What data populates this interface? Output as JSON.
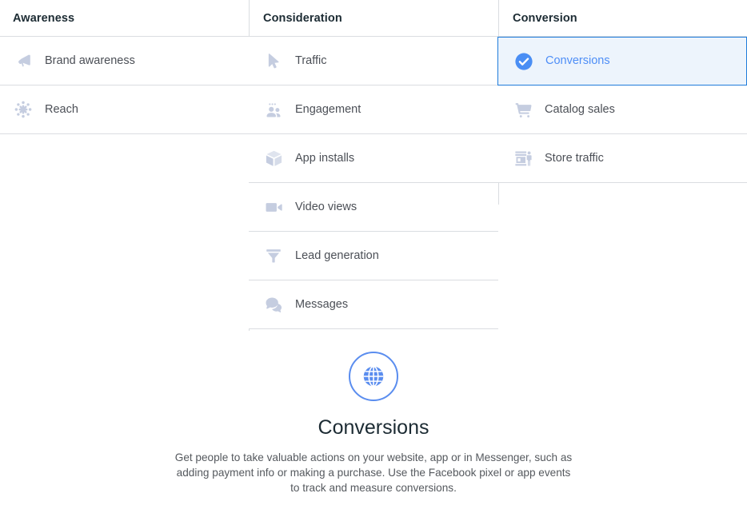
{
  "columns": [
    {
      "id": "awareness",
      "header": "Awareness",
      "items": [
        {
          "label": "Brand awareness",
          "icon": "megaphone-icon",
          "selected": false
        },
        {
          "label": "Reach",
          "icon": "reach-burst-icon",
          "selected": false
        }
      ]
    },
    {
      "id": "consideration",
      "header": "Consideration",
      "items": [
        {
          "label": "Traffic",
          "icon": "cursor-arrow-icon",
          "selected": false
        },
        {
          "label": "Engagement",
          "icon": "people-group-icon",
          "selected": false
        },
        {
          "label": "App installs",
          "icon": "box-cube-icon",
          "selected": false
        },
        {
          "label": "Video views",
          "icon": "video-camera-icon",
          "selected": false
        },
        {
          "label": "Lead generation",
          "icon": "funnel-icon",
          "selected": false
        },
        {
          "label": "Messages",
          "icon": "speech-bubbles-icon",
          "selected": false
        }
      ]
    },
    {
      "id": "conversion",
      "header": "Conversion",
      "items": [
        {
          "label": "Conversions",
          "icon": "check-circle-icon",
          "selected": true
        },
        {
          "label": "Catalog sales",
          "icon": "shopping-cart-icon",
          "selected": false
        },
        {
          "label": "Store traffic",
          "icon": "storefront-icon",
          "selected": false
        }
      ]
    }
  ],
  "detail": {
    "badge_icon": "globe-icon",
    "title": "Conversions",
    "description": "Get people to take valuable actions on your website, app or in Messenger, such as adding payment info or making a purchase. Use the Facebook pixel or app events to track and measure conversions."
  },
  "colors": {
    "selected_border": "#1f7cdb",
    "selected_background": "#edf4fc",
    "selected_text": "#4e8ef7",
    "accent_blue": "#5a8def",
    "icon_grey": "#c5cde0",
    "divider": "#dadde1",
    "header_text": "#1c2b33",
    "label_text": "#4b4f56"
  }
}
